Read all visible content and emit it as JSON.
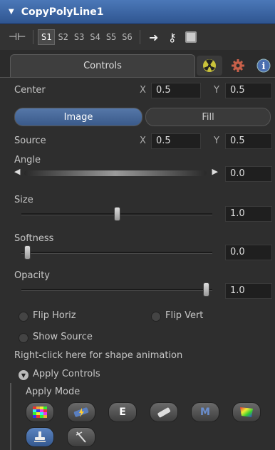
{
  "window": {
    "title": "CopyPolyLine1",
    "collapse_glyph": "▼"
  },
  "toolbar": {
    "slots": [
      "S1",
      "S2",
      "S3",
      "S4",
      "S5",
      "S6"
    ],
    "active_slot": "S1",
    "icons": [
      "pin-icon",
      "arrow-right-icon",
      "key-icon",
      "save-disk-icon"
    ]
  },
  "tabs": {
    "controls_label": "Controls",
    "icons": [
      "radioactive-icon",
      "gear-icon",
      "info-icon"
    ]
  },
  "controls": {
    "center": {
      "label": "Center",
      "x_label": "X",
      "x": "0.5",
      "y_label": "Y",
      "y": "0.5"
    },
    "mode_toggle": {
      "image_label": "Image",
      "fill_label": "Fill",
      "selected": "Image"
    },
    "source": {
      "label": "Source",
      "x_label": "X",
      "x": "0.5",
      "y_label": "Y",
      "y": "0.5"
    },
    "angle": {
      "label": "Angle",
      "value": "0.0"
    },
    "size": {
      "label": "Size",
      "value": "1.0",
      "fraction": 0.5
    },
    "softness": {
      "label": "Softness",
      "value": "0.0",
      "fraction": 0.0
    },
    "opacity": {
      "label": "Opacity",
      "value": "1.0",
      "fraction": 1.0
    },
    "flip_horiz_label": "Flip Horiz",
    "flip_vert_label": "Flip Vert",
    "show_source_label": "Show Source",
    "right_click_hint": "Right-click here for shape animation",
    "apply_controls_label": "Apply Controls",
    "apply_mode_label": "Apply Mode",
    "apply_mode_buttons": [
      "color-grid-icon",
      "lightning-icon",
      "E",
      "eraser-icon",
      "M",
      "rainbow-icon",
      "stamp-icon",
      "wand-icon"
    ],
    "selected_apply_mode": "stamp-icon"
  },
  "colors": {
    "title_bar": "#3d67a6",
    "selected_toggle": "#4a6ea3",
    "field_bg": "#1f1f1f"
  }
}
